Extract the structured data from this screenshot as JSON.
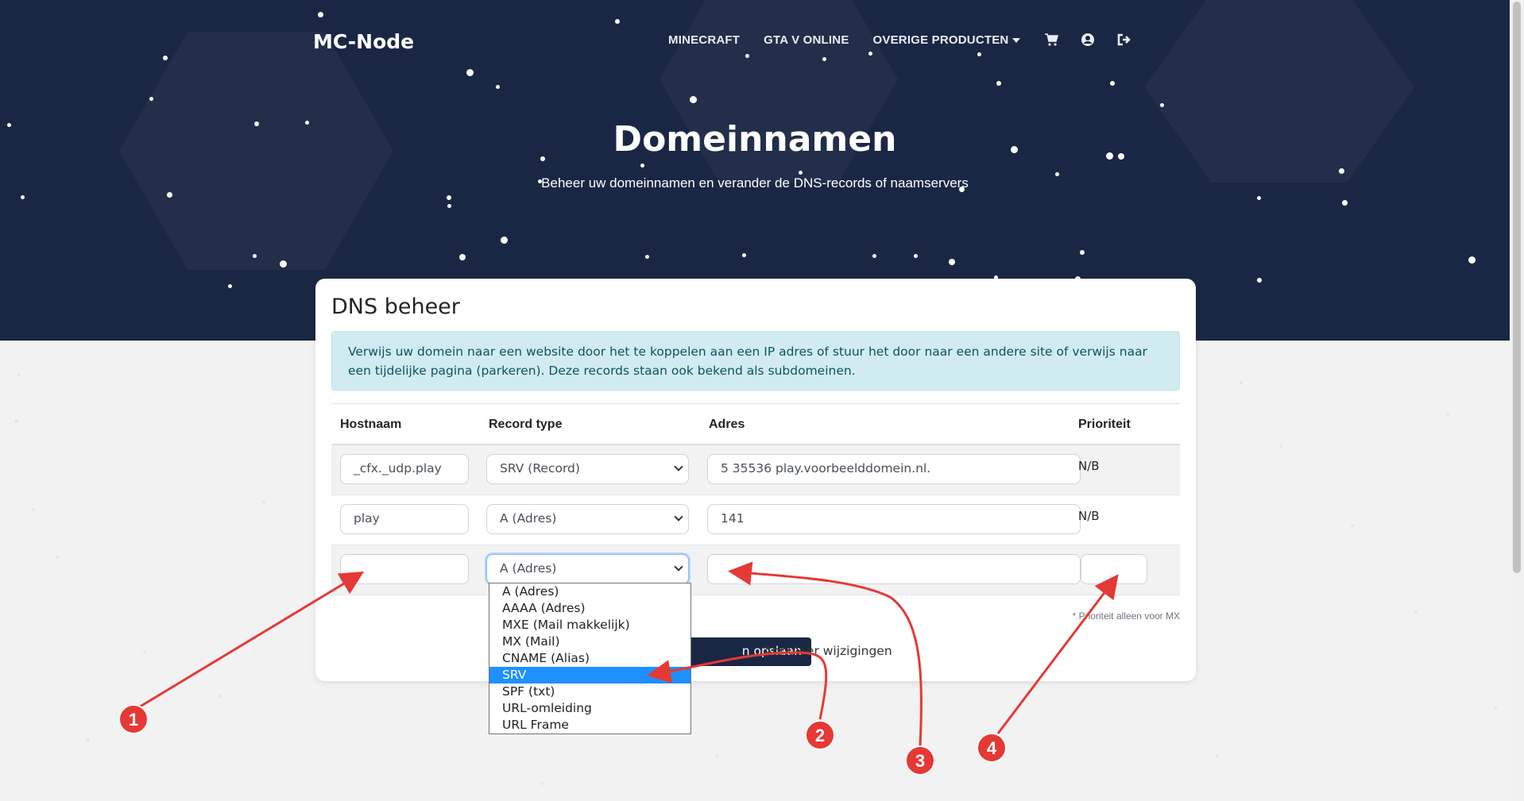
{
  "brand": "MC-Node",
  "nav": {
    "items": [
      {
        "label": "MINECRAFT"
      },
      {
        "label": "GTA V ONLINE"
      },
      {
        "label": "OVERIGE PRODUCTEN"
      }
    ],
    "icons": [
      "cart-icon",
      "user-circle-icon",
      "sign-out-icon"
    ]
  },
  "hero": {
    "title": "Domeinnamen",
    "subtitle": "Beheer uw domeinnamen en verander de DNS-records of naamservers"
  },
  "card": {
    "title": "DNS beheer",
    "alert": "Verwijs uw domein naar een website door het te koppelen aan een IP adres of stuur het door naar een andere site of verwijs naar een tijdelijke pagina (parkeren). Deze records staan ook bekend als subdomeinen."
  },
  "table": {
    "headers": {
      "hostname": "Hostnaam",
      "record_type": "Record type",
      "address": "Adres",
      "priority": "Prioriteit"
    },
    "rows": [
      {
        "hostname": "_cfx._udp.play",
        "record_type": "SRV (Record)",
        "address": "5 35536 play.voorbeelddomein.nl.",
        "priority": "N/B"
      },
      {
        "hostname": "play",
        "record_type": "A (Adres)",
        "address": "141",
        "priority": "N/B"
      },
      {
        "hostname": "",
        "record_type": "A (Adres)",
        "address": "",
        "priority": ""
      }
    ],
    "note": "* Prioriteit alleen voor MX"
  },
  "actions": {
    "save_label": "n opslaan",
    "cancel_label": "Annuleer wijzigingen"
  },
  "dropdown": {
    "options": [
      "A (Adres)",
      "AAAA (Adres)",
      "MXE (Mail makkelijk)",
      "MX (Mail)",
      "CNAME (Alias)",
      "SRV",
      "SPF (txt)",
      "URL-omleiding",
      "URL Frame"
    ],
    "highlighted": "SRV"
  },
  "annotations": {
    "color": "#e53935",
    "badges": [
      "1",
      "2",
      "3",
      "4"
    ]
  },
  "colors": {
    "hero_bg": "#1a2744",
    "alert_bg": "#d1ecf1",
    "alert_text": "#0c5460",
    "selected_option": "#1e90ff"
  }
}
